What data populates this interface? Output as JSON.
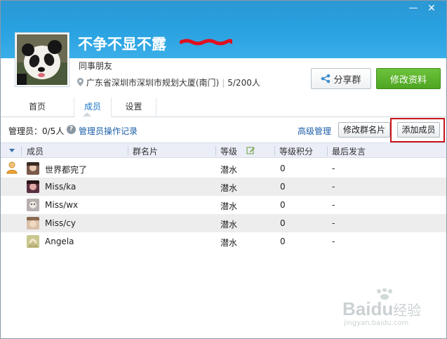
{
  "window": {
    "minimize_icon": "minimize-icon",
    "close_icon": "close-icon"
  },
  "group": {
    "name": "不争不显不露",
    "category": "同事朋友",
    "location": "广东省深圳市深圳市规划大厦(南门)",
    "member_count": "5/200人"
  },
  "actions": {
    "share_label": "分享群",
    "edit_label": "修改资料"
  },
  "tabs": [
    {
      "label": "首页"
    },
    {
      "label": "成员"
    },
    {
      "label": "设置"
    }
  ],
  "toolbar": {
    "admin_count": "管理员：0/5人",
    "admin_log": "管理员操作记录",
    "advanced": "高级管理",
    "rename": "修改群名片",
    "add_member": "添加成员"
  },
  "table": {
    "headers": [
      "成员",
      "群名片",
      "等级",
      "等级积分",
      "最后发言"
    ],
    "rows": [
      {
        "name": "世界都完了",
        "card": "",
        "level": "潜水",
        "points": "0",
        "last": "-"
      },
      {
        "name": "Miss/ka",
        "card": "",
        "level": "潜水",
        "points": "0",
        "last": "-"
      },
      {
        "name": "Miss/wx",
        "card": "",
        "level": "潜水",
        "points": "0",
        "last": "-"
      },
      {
        "name": "Miss/cy",
        "card": "",
        "level": "潜水",
        "points": "0",
        "last": "-"
      },
      {
        "name": "Angela",
        "card": "",
        "level": "潜水",
        "points": "0",
        "last": "-"
      }
    ]
  },
  "watermark": {
    "brand": "Bai",
    "brand2": "du",
    "suffix": "经验",
    "url": "jingyan.baidu.com"
  },
  "colors": {
    "header": "#27a0e0",
    "accent_green": "#5cb42e",
    "link": "#1b5fa8",
    "highlight": "#c8141a"
  }
}
